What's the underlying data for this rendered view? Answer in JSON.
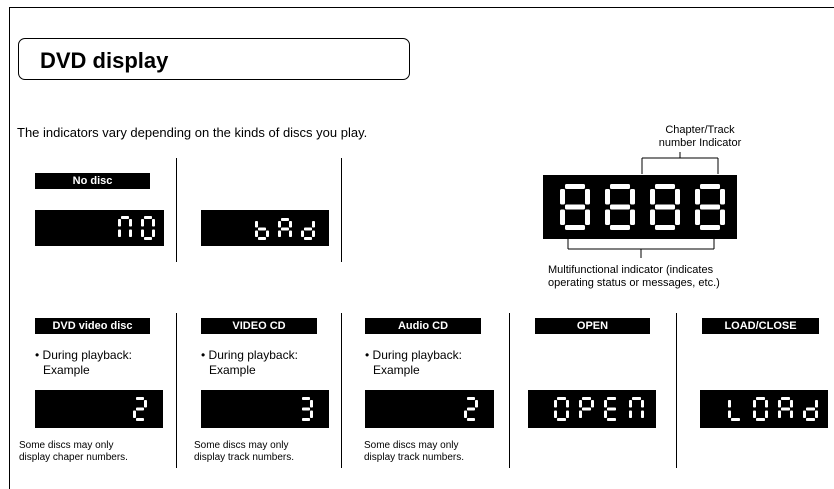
{
  "page": {
    "title": "DVD display",
    "intro": "The indicators vary depending on the kinds of discs you play."
  },
  "top_row": {
    "no_disc_label": "No disc",
    "no_disc_display": "no",
    "bad_display": "bAd"
  },
  "indicator_diagram": {
    "display_digits": "8888",
    "chapter_track_callout_line1": "Chapter/Track",
    "chapter_track_callout_line2": "number Indicator",
    "multifunctional_callout_line1": "Multifunctional indicator (indicates",
    "multifunctional_callout_line2": "operating status or messages, etc.)"
  },
  "bottom_row": {
    "dvd_video": {
      "label": "DVD video disc",
      "bullet_line1": "• During playback:",
      "bullet_line2": "Example",
      "display": "2",
      "note_line1": "Some discs may only",
      "note_line2": "display chaper numbers."
    },
    "video_cd": {
      "label": "VIDEO CD",
      "bullet_line1": "• During playback:",
      "bullet_line2": "Example",
      "display": "3",
      "note_line1": "Some discs may only",
      "note_line2": "display track numbers."
    },
    "audio_cd": {
      "label": "Audio CD",
      "bullet_line1": "• During playback:",
      "bullet_line2": "Example",
      "display": "2",
      "note_line1": "Some discs may only",
      "note_line2": "display track numbers."
    },
    "open": {
      "label": "OPEN",
      "display": "OPEN"
    },
    "load_close": {
      "label": "LOAD/CLOSE",
      "display": "LOAd"
    }
  },
  "colors": {
    "display_bg": "#000000",
    "segment": "#ffffff"
  }
}
